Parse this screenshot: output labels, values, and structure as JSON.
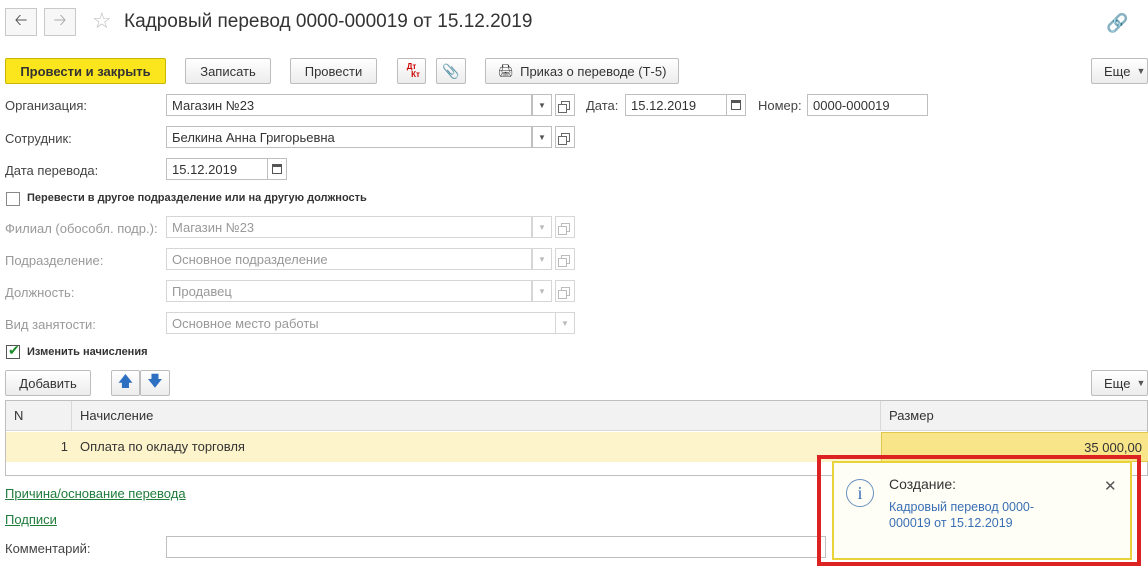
{
  "window": {
    "title": "Кадровый перевод 0000-000019 от 15.12.2019"
  },
  "toolbar": {
    "post_close": "Провести и закрыть",
    "save": "Записать",
    "post": "Провести",
    "dtkt_top": "Дт",
    "dtkt_bottom": "Кт",
    "print_order": "Приказ о переводе (Т-5)",
    "more": "Еще"
  },
  "form": {
    "org_label": "Организация:",
    "org_value": "Магазин №23",
    "date_label": "Дата:",
    "date_value": "15.12.2019",
    "number_label": "Номер:",
    "number_value": "0000-000019",
    "employee_label": "Сотрудник:",
    "employee_value": "Белкина Анна Григорьевна",
    "transfer_date_label": "Дата перевода:",
    "transfer_date_value": "15.12.2019",
    "transfer_checkbox_label": "Перевести в другое подразделение или на другую должность",
    "transfer_checked": false,
    "branch_label": "Филиал (обособл. подр.):",
    "branch_value": "Магазин №23",
    "department_label": "Подразделение:",
    "department_value": "Основное подразделение",
    "position_label": "Должность:",
    "position_value": "Продавец",
    "employment_label": "Вид занятости:",
    "employment_value": "Основное место работы",
    "change_accruals_label": "Изменить начисления",
    "change_accruals_checked": true
  },
  "table_toolbar": {
    "add": "Добавить",
    "more": "Еще"
  },
  "table": {
    "columns": [
      "N",
      "Начисление",
      "Размер"
    ],
    "rows": [
      {
        "n": "1",
        "accrual": "Оплата по окладу торговля",
        "amount": "35 000,00"
      }
    ]
  },
  "links": {
    "reason": "Причина/основание перевода",
    "signatures": "Подписи"
  },
  "comment": {
    "label": "Комментарий:",
    "value": ""
  },
  "notification": {
    "title": "Создание:",
    "text": "Кадровый перевод 0000-000019 от 15.12.2019"
  }
}
